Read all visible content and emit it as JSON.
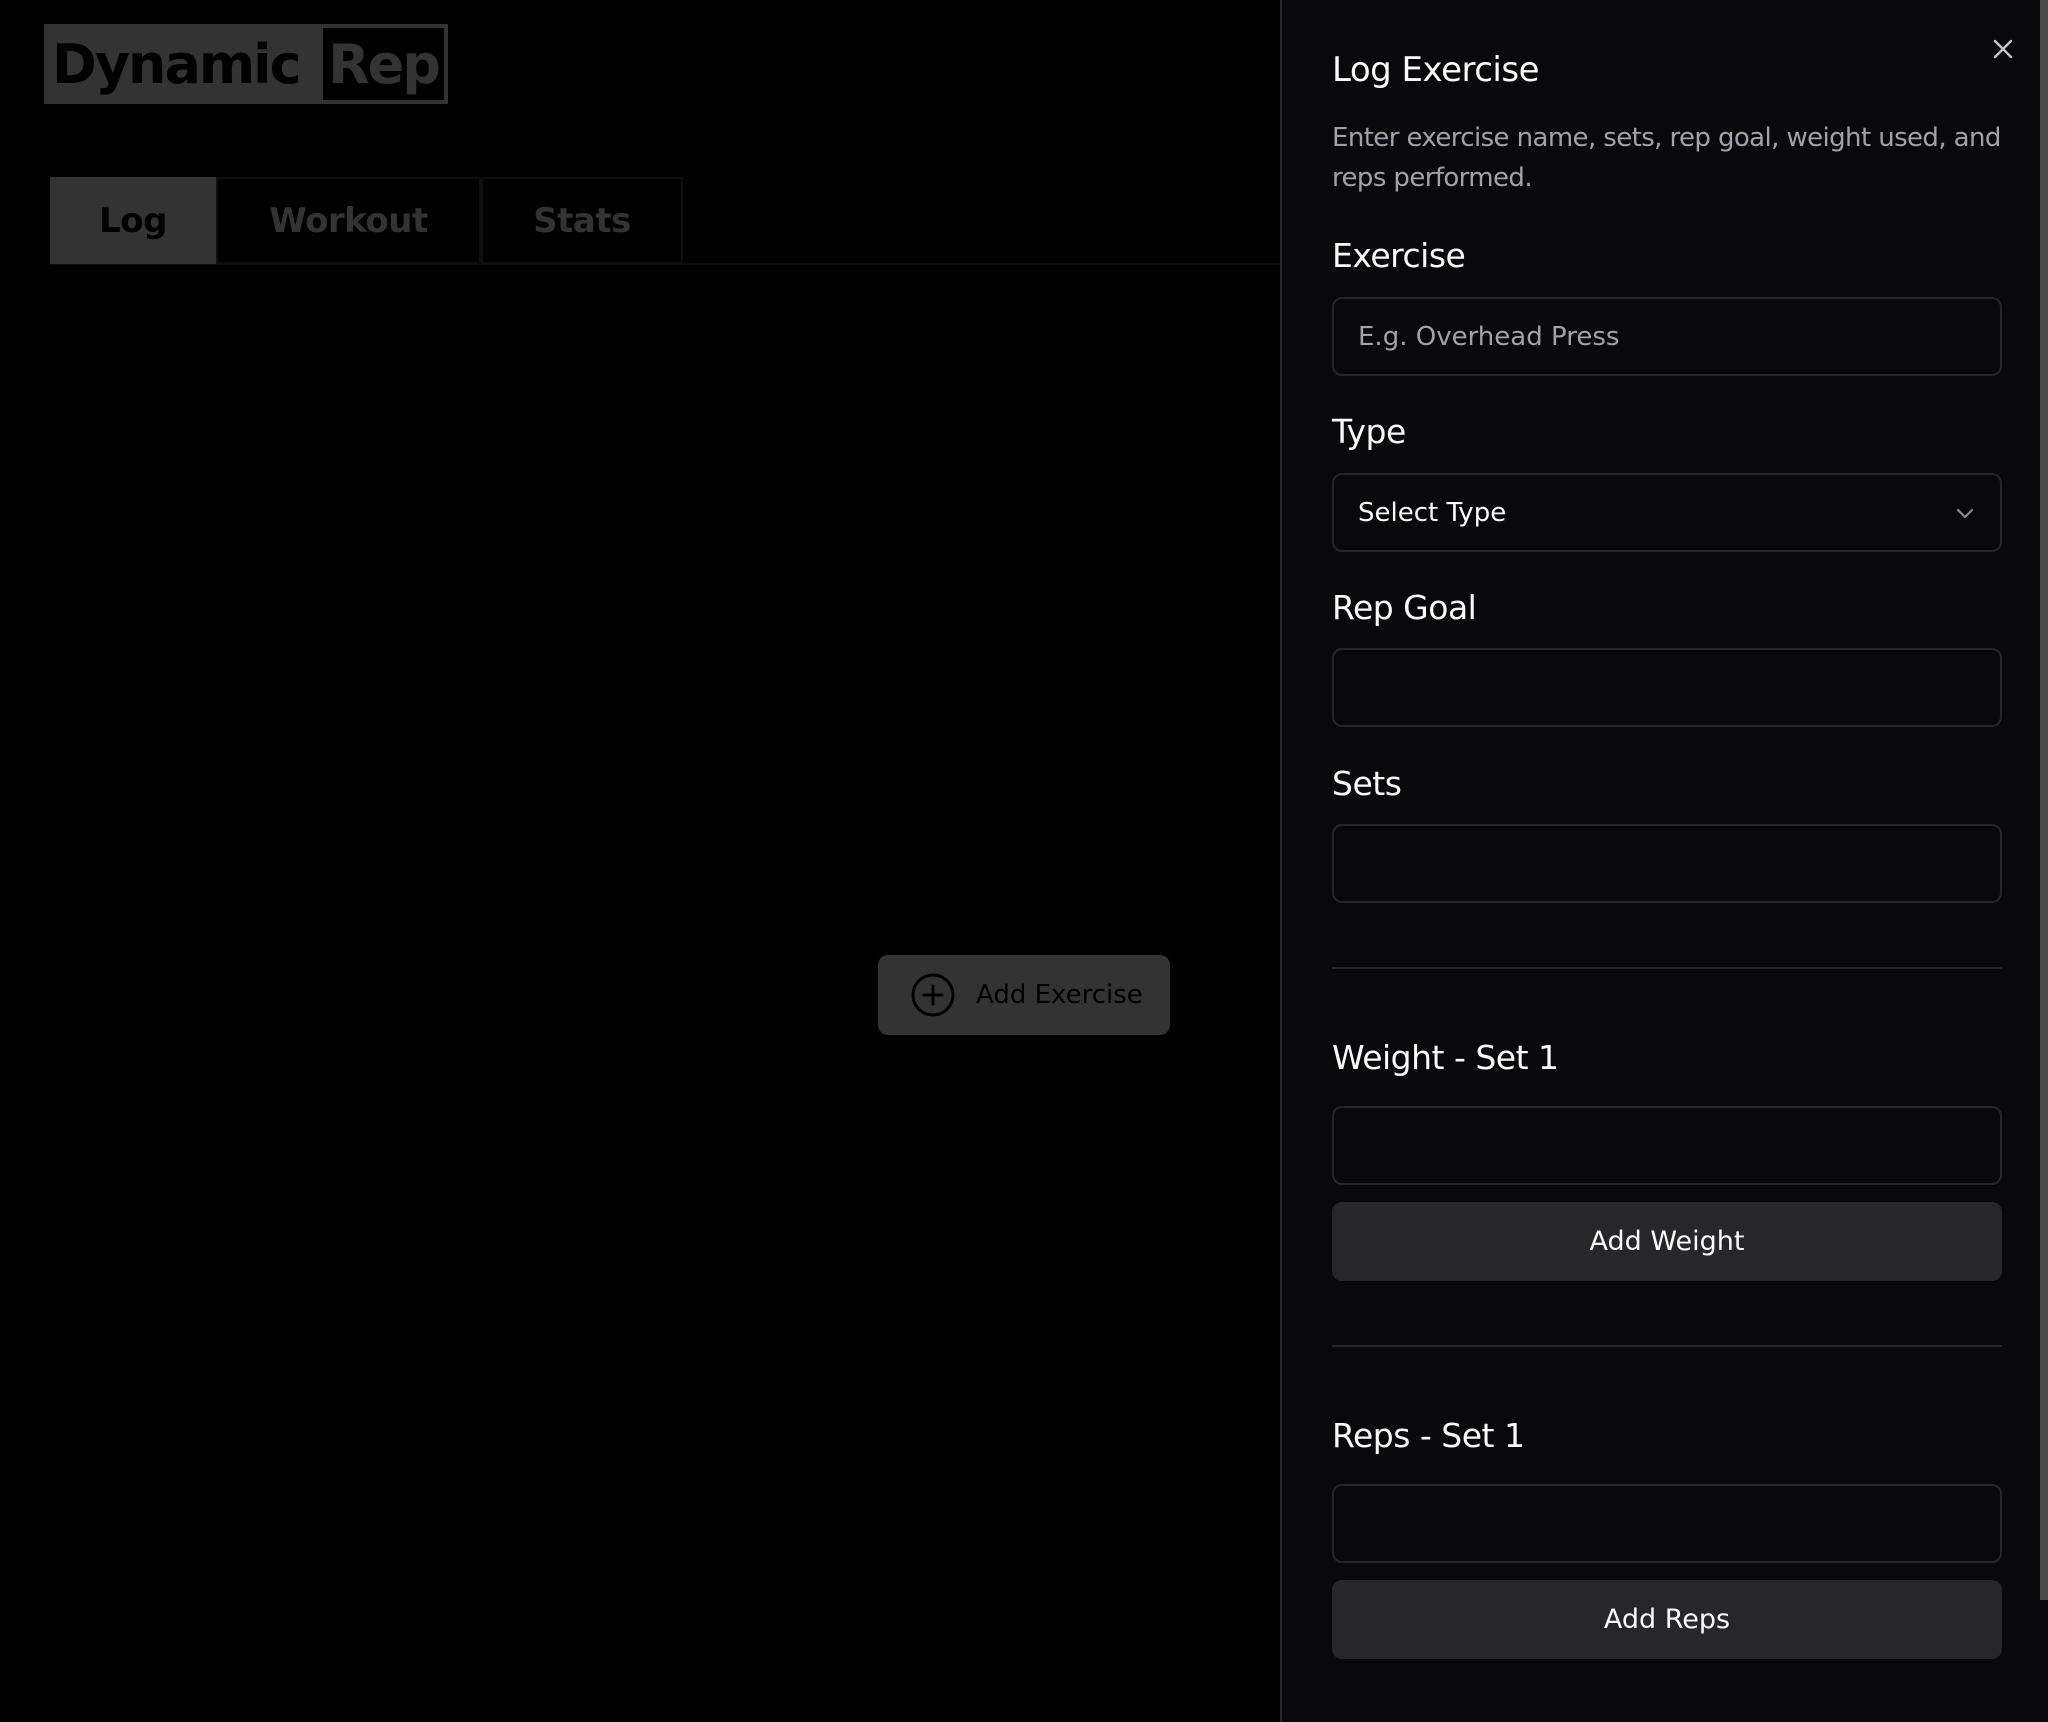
{
  "app": {
    "logo": {
      "part1": "Dynamic",
      "part2": "Rep"
    }
  },
  "tabs": [
    {
      "label": "Log",
      "active": true
    },
    {
      "label": "Workout",
      "active": false
    },
    {
      "label": "Stats",
      "active": false
    }
  ],
  "main": {
    "add_exercise_label": "Add Exercise",
    "add_exercise_icon": "plus-circle-icon"
  },
  "panel": {
    "title": "Log Exercise",
    "description": "Enter exercise name, sets, rep goal, weight used, and reps performed.",
    "close_icon": "close-icon",
    "fields": {
      "exercise": {
        "label": "Exercise",
        "value": "",
        "placeholder": "E.g. Overhead Press"
      },
      "type": {
        "label": "Type",
        "selected": "Select Type"
      },
      "rep_goal": {
        "label": "Rep Goal",
        "value": "",
        "placeholder": ""
      },
      "sets": {
        "label": "Sets",
        "value": "",
        "placeholder": ""
      },
      "weight_set1": {
        "label": "Weight - Set 1",
        "value": "",
        "placeholder": ""
      },
      "reps_set1": {
        "label": "Reps - Set 1",
        "value": "",
        "placeholder": ""
      }
    },
    "buttons": {
      "add_weight": "Add Weight",
      "add_reps": "Add Reps"
    }
  },
  "colors": {
    "page_bg": "#000000",
    "panel_bg": "#09090b",
    "border": "#27272a",
    "muted_text": "#a1a1aa",
    "text": "#fafafa",
    "overlay_gray": "#333333"
  }
}
